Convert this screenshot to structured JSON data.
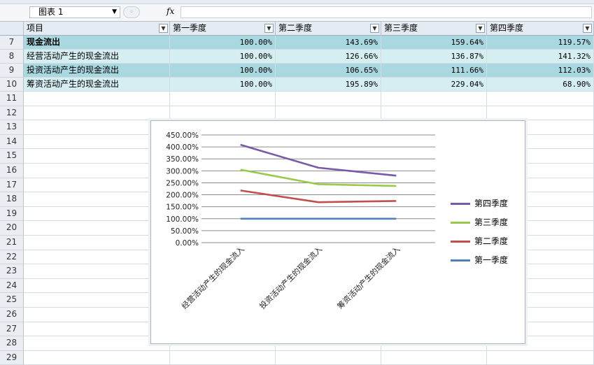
{
  "formula_bar": {
    "name_box": "图表 1",
    "fx": "fx"
  },
  "headers": [
    {
      "label": "项目"
    },
    {
      "label": "第一季度"
    },
    {
      "label": "第二季度"
    },
    {
      "label": "第三季度"
    },
    {
      "label": "第四季度"
    }
  ],
  "rows": [
    {
      "num": "7",
      "label": "现金流出",
      "bold": true,
      "values": [
        "100.00%",
        "143.69%",
        "159.64%",
        "119.57%"
      ]
    },
    {
      "num": "8",
      "label": "经营活动产生的现金流出",
      "values": [
        "100.00%",
        "126.66%",
        "136.87%",
        "141.32%"
      ]
    },
    {
      "num": "9",
      "label": "投资活动产生的现金流出",
      "values": [
        "100.00%",
        "106.65%",
        "111.66%",
        "112.03%"
      ]
    },
    {
      "num": "10",
      "label": "筹资活动产生的现金流出",
      "values": [
        "100.00%",
        "195.89%",
        "229.04%",
        "68.90%"
      ]
    }
  ],
  "empty_rows": [
    "11",
    "12",
    "13",
    "14",
    "15",
    "16",
    "17",
    "18",
    "19",
    "20",
    "21",
    "22",
    "23",
    "24",
    "25",
    "26",
    "27",
    "28",
    "29"
  ],
  "colors": {
    "band_dark": "#a9d8e0",
    "band_light": "#d5eef2",
    "header_bg": "#e4ebf2"
  },
  "chart_data": {
    "type": "line",
    "categories": [
      "经营活动产生的现金流入",
      "投资活动产生的现金流入",
      "筹资活动产生的现金流入"
    ],
    "ylim": [
      0,
      450
    ],
    "yticks": [
      "0.00%",
      "50.00%",
      "100.00%",
      "150.00%",
      "200.00%",
      "250.00%",
      "300.00%",
      "350.00%",
      "400.00%",
      "450.00%"
    ],
    "legend_position": "right",
    "grid": true,
    "series": [
      {
        "name": "第四季度",
        "color": "#7b59a6",
        "values": [
          409,
          313,
          280
        ]
      },
      {
        "name": "第三季度",
        "color": "#9bc94a",
        "values": [
          305,
          244,
          237
        ]
      },
      {
        "name": "第二季度",
        "color": "#c0504d",
        "values": [
          218,
          169,
          174
        ]
      },
      {
        "name": "第一季度",
        "color": "#4f81bd",
        "values": [
          100,
          100,
          100
        ]
      }
    ]
  }
}
